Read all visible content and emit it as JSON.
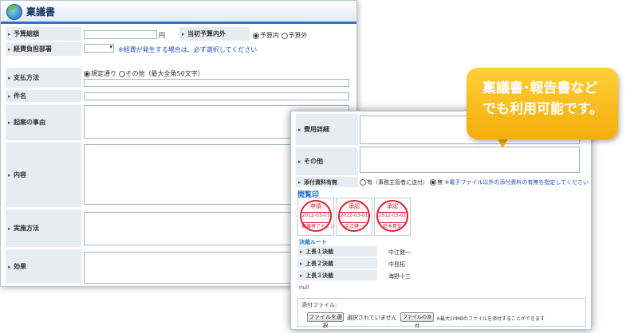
{
  "window1": {
    "title": "稟議書",
    "fields": {
      "budget_total": {
        "label": "予算総額",
        "unit": "円"
      },
      "initial_budget": {
        "label": "当初予算内外",
        "opt_in": "予算内",
        "opt_out": "予算外"
      },
      "expense_dept": {
        "label": "経費負担部署",
        "note": "※経費が発生する場合は、必ず選択してください"
      },
      "payment": {
        "label": "支払方法",
        "opt_default": "規定通り",
        "opt_other": "その他（最大全角50文字）"
      },
      "subject": {
        "label": "件名"
      },
      "reason": {
        "label": "起案の事由"
      },
      "content": {
        "label": "内容"
      },
      "method": {
        "label": "実施方法"
      },
      "effect": {
        "label": "効果"
      }
    }
  },
  "window2": {
    "cost_detail": {
      "label": "費用詳細"
    },
    "other": {
      "label": "その他"
    },
    "attachments": {
      "label": "添付資料有無",
      "opt_yes": "有（事務主管者に送付）",
      "opt_no": "無",
      "note": "※電子ファイル以外の添付資料の有無を指定してください"
    },
    "circulation_label": "閲覧印",
    "stamps": [
      {
        "top": "申請",
        "date": "2012-03-01",
        "name": "稟議者アドミン"
      },
      {
        "top": "承認",
        "date": "2012-03-01",
        "name": "中江健一"
      },
      {
        "top": "承認",
        "date": "2012-03-01",
        "name": "鈴木貴史"
      }
    ],
    "approval_route": {
      "title": "決裁ルート",
      "rows": [
        {
          "label": "上長１決裁",
          "value": "中江健一"
        },
        {
          "label": "上長２決裁",
          "value": "中島拓"
        },
        {
          "label": "上長３決裁",
          "value": "海野十三"
        }
      ]
    },
    "null_text": "null",
    "attachment_file": {
      "label": "添付ファイル:",
      "choose_button": "ファイルを選択",
      "no_file": "選択されていません",
      "attach_button": "ファイルの添付",
      "max_note": "※最大10MBのファイルを添付することができます"
    }
  },
  "callout": {
    "line1": "稟議書･報告書など",
    "line2": "でも利用可能です。"
  },
  "colors": {
    "accent": "#2d74c4",
    "callout": "#f5ad0a",
    "stamp": "#d82030",
    "note": "#1f4fbf"
  }
}
